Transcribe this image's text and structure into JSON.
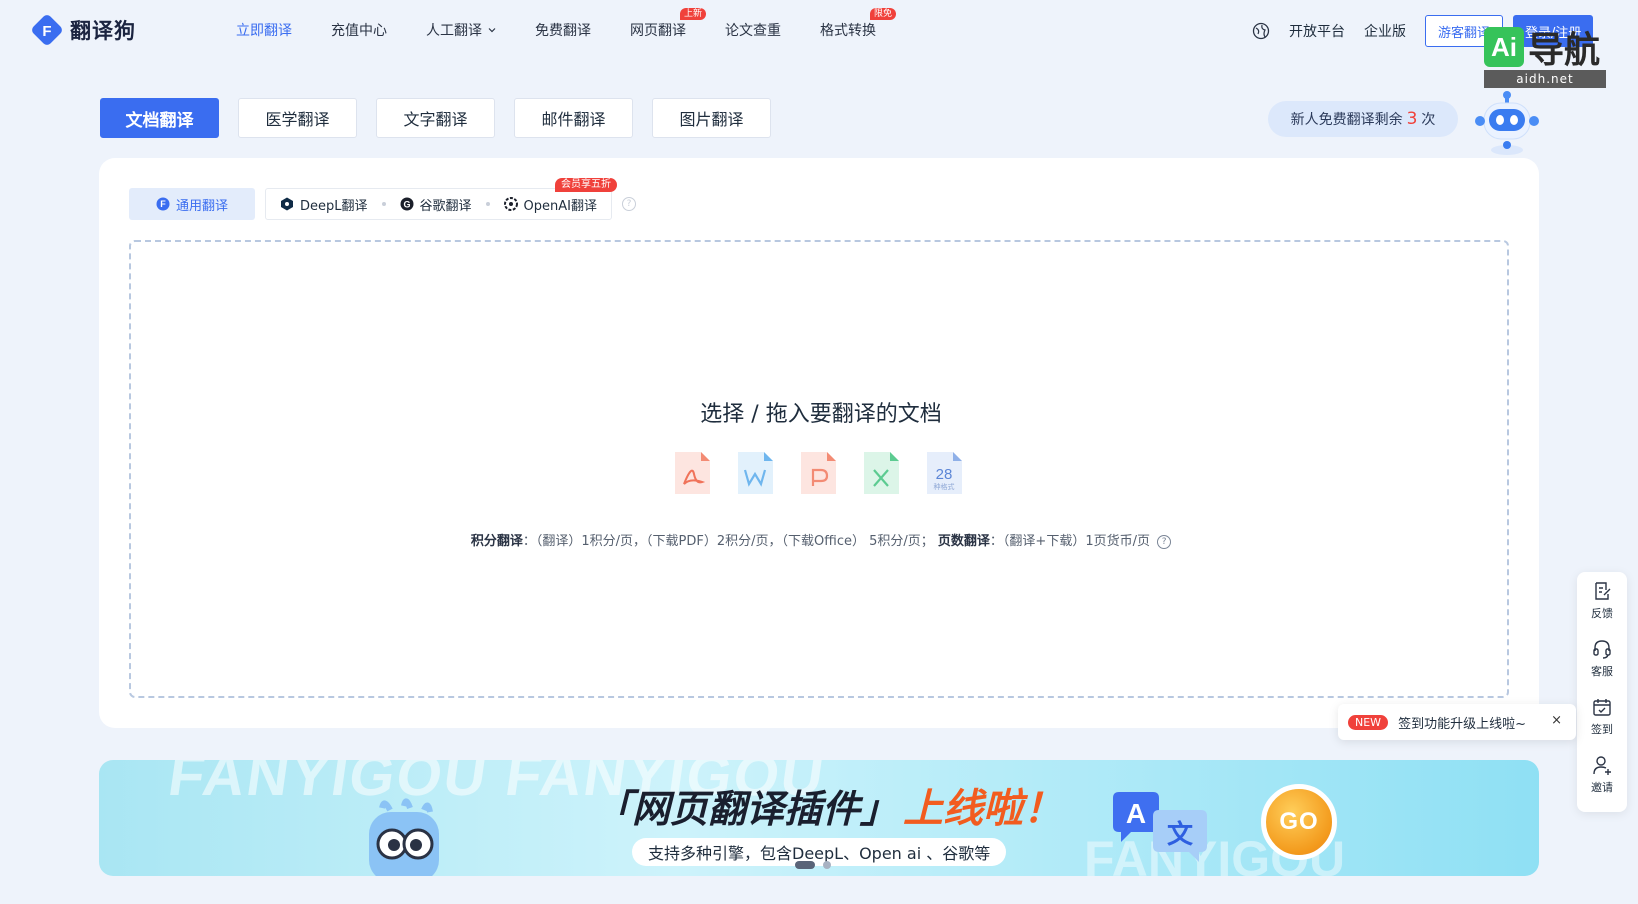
{
  "brand": {
    "name": "翻译狗"
  },
  "nav": {
    "items": [
      {
        "label": "立即翻译",
        "active": true,
        "badge": ""
      },
      {
        "label": "充值中心",
        "badge": ""
      },
      {
        "label": "人工翻译",
        "badge": "",
        "dropdown": true
      },
      {
        "label": "免费翻译",
        "badge": ""
      },
      {
        "label": "网页翻译",
        "badge": "上新"
      },
      {
        "label": "论文查重",
        "badge": ""
      },
      {
        "label": "格式转换",
        "badge": "限免"
      }
    ]
  },
  "header_right": {
    "open_platform": "开放平台",
    "enterprise": "企业版",
    "guest_button": "游客翻译",
    "login_button": "登录/注册"
  },
  "watermark": {
    "ai": "Ai",
    "text": "导航",
    "url": "aidh.net"
  },
  "doc_tabs": [
    "文档翻译",
    "医学翻译",
    "文字翻译",
    "邮件翻译",
    "图片翻译"
  ],
  "quota": {
    "prefix": "新人免费翻译剩余",
    "count": "3",
    "suffix": "次"
  },
  "engines": {
    "active": "通用翻译",
    "items": [
      "DeepL翻译",
      "谷歌翻译",
      "OpenAI翻译"
    ],
    "member_badge": "会员享五折"
  },
  "upload": {
    "title": "选择 / 拖入要翻译的文档",
    "formats_count": "28",
    "formats_label": "种格式",
    "note_points_label": "积分翻译",
    "note_points": "：（翻译）1积分/页，（下载PDF）2积分/页，（下载Office） 5积分/页；",
    "note_pages_label": "页数翻译",
    "note_pages": "：（翻译+下载）1页货币/页"
  },
  "banner": {
    "ghost": "FANYIGOU FANYIGOU",
    "ghost2": "FANYIGOU",
    "title": "「网页翻译插件」",
    "title_highlight": "上线啦！",
    "subtitle": "支持多种引擎，包含DeepL、Open ai 、谷歌等",
    "go": "GO",
    "slide_index": 1,
    "slide_total": 2
  },
  "float_bar": [
    "反馈",
    "客服",
    "签到",
    "邀请"
  ],
  "toast": {
    "badge": "NEW",
    "text": "签到功能升级上线啦~",
    "close": "×"
  },
  "colors": {
    "primary": "#3a6df0",
    "accent_red": "#f0413b",
    "banner_orange": "#f25c1f"
  }
}
